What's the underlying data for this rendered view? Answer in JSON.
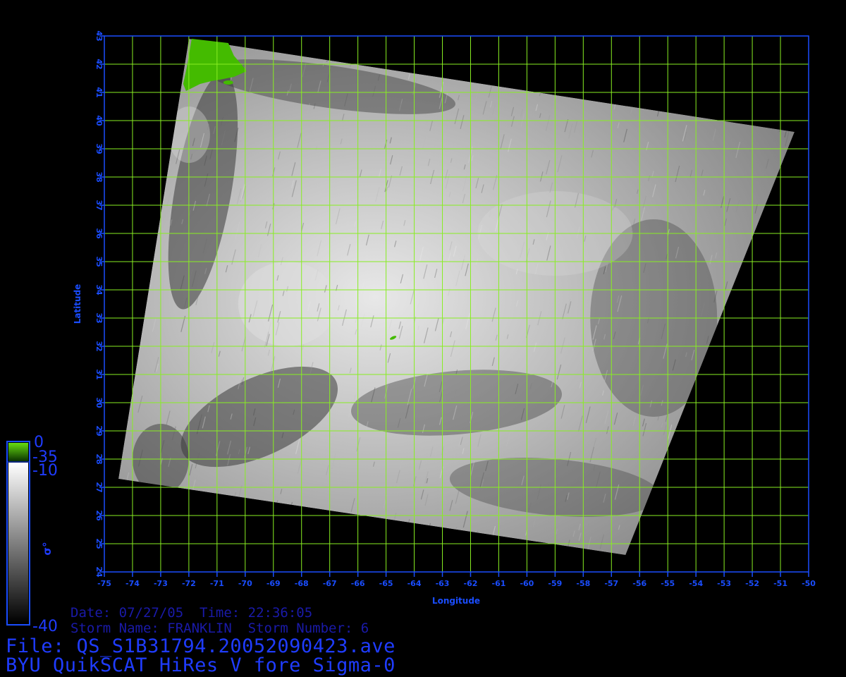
{
  "map": {
    "xlabel": "Longitude",
    "ylabel": "Latitude",
    "lon_range": [
      -75,
      -50
    ],
    "lat_range": [
      24,
      43
    ],
    "lon_ticks": [
      "-75",
      "-74",
      "-73",
      "-72",
      "-71",
      "-70",
      "-69",
      "-68",
      "-67",
      "-66",
      "-65",
      "-64",
      "-63",
      "-62",
      "-61",
      "-60",
      "-59",
      "-58",
      "-57",
      "-56",
      "-55",
      "-54",
      "-53",
      "-52",
      "-51",
      "-50"
    ],
    "lat_ticks": [
      "24",
      "25",
      "26",
      "27",
      "28",
      "29",
      "30",
      "31",
      "32",
      "33",
      "34",
      "35",
      "36",
      "37",
      "38",
      "39",
      "40",
      "41",
      "42",
      "43"
    ],
    "grid": true,
    "swath_corners_lonlat": [
      [
        -72.0,
        42.9
      ],
      [
        -50.5,
        39.6
      ],
      [
        -56.5,
        24.6
      ],
      [
        -74.5,
        27.3
      ]
    ],
    "land_region": "New England coast (top-left)"
  },
  "colorbar": {
    "label": "σ°",
    "land_top_label": "0",
    "land_bottom_label": "-35",
    "gray_top_label": "-10",
    "gray_bottom_label": "-40"
  },
  "info": {
    "date_line": "Date: 07/27/05  Time: 22:36:05",
    "storm_line": "Storm Name: FRANKLIN  Storm Number: 6",
    "file_line": "File: QS_S1B31794.20052090423.ave",
    "product_line": "BYU QuikSCAT HiRes V fore Sigma-0"
  },
  "colors": {
    "background": "#000000",
    "axis": "#1a4dff",
    "grid": "#88ee22",
    "land": "#44bb00",
    "info_text": "#1a1aa8",
    "title_text": "#1f3cff",
    "swath_light": "#e0e0e0",
    "swath_dark": "#3a3a3a"
  }
}
